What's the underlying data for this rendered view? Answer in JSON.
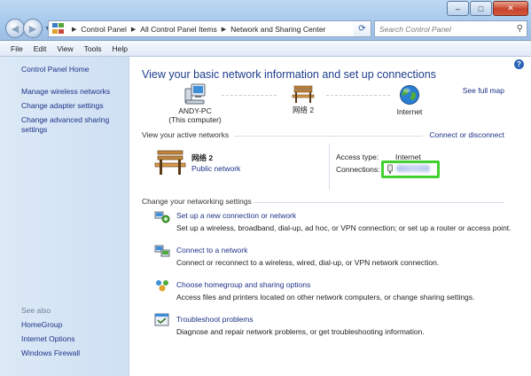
{
  "window": {
    "minimize": "–",
    "maximize": "□",
    "close": "✕"
  },
  "address": {
    "breadcrumbs": [
      "Control Panel",
      "All Control Panel Items",
      "Network and Sharing Center"
    ],
    "search_placeholder": "Search Control Panel"
  },
  "menu": [
    "File",
    "Edit",
    "View",
    "Tools",
    "Help"
  ],
  "sidebar": {
    "home": "Control Panel Home",
    "links": [
      "Manage wireless networks",
      "Change adapter settings",
      "Change advanced sharing settings"
    ],
    "see_also_heading": "See also",
    "see_also": [
      "HomeGroup",
      "Internet Options",
      "Windows Firewall"
    ]
  },
  "main": {
    "heading": "View your basic network information and set up connections",
    "see_full_map": "See full map",
    "map": {
      "computer_name": "ANDY-PC",
      "computer_sub": "(This computer)",
      "network": "网络  2",
      "internet": "Internet"
    },
    "active_networks_label": "View your active networks",
    "connect_or_disconnect": "Connect or disconnect",
    "active_network": {
      "name": "网络  2",
      "category": "Public network",
      "access_type_label": "Access type:",
      "access_type_value": "Internet",
      "connections_label": "Connections:"
    },
    "change_settings_label": "Change your networking settings",
    "tasks": [
      {
        "title": "Set up a new connection or network",
        "desc": "Set up a wireless, broadband, dial-up, ad hoc, or VPN connection; or set up a router or access point."
      },
      {
        "title": "Connect to a network",
        "desc": "Connect or reconnect to a wireless, wired, dial-up, or VPN network connection."
      },
      {
        "title": "Choose homegroup and sharing options",
        "desc": "Access files and printers located on other network computers, or change sharing settings."
      },
      {
        "title": "Troubleshoot problems",
        "desc": "Diagnose and repair network problems, or get troubleshooting information."
      }
    ]
  },
  "colors": {
    "link": "#1e3287",
    "heading": "#1e3d8c",
    "highlight_box": "#40d12f"
  }
}
